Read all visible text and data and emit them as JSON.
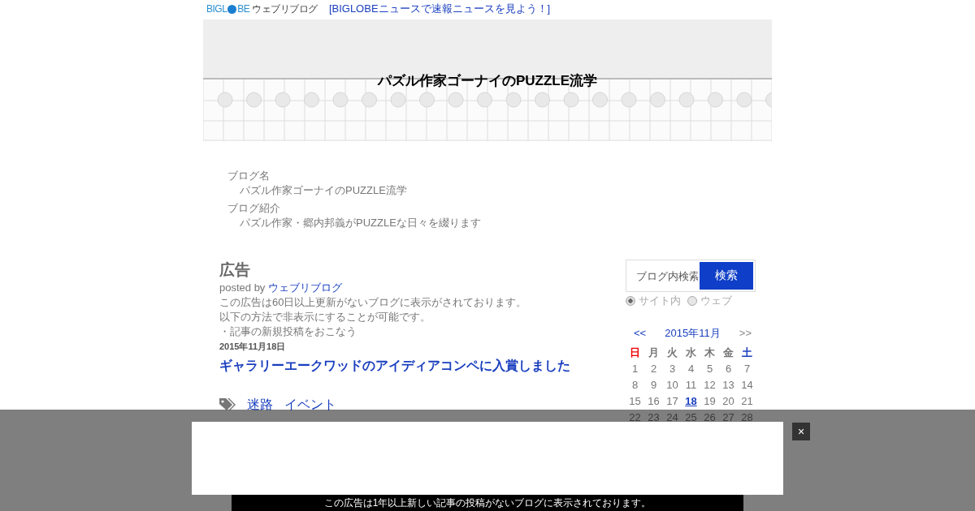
{
  "topbar": {
    "logo": {
      "left": "BIGL",
      "right": "BE",
      "suffix": "ウェブリブログ"
    },
    "news_link": "[BIGLOBEニュースで速報ニュースを見よう！]"
  },
  "banner": {
    "title": "パズル作家ゴーナイのPUZZLE流学"
  },
  "blog_info": [
    {
      "label": "ブログ名",
      "value": "パズル作家ゴーナイのPUZZLE流学"
    },
    {
      "label": "ブログ紹介",
      "value": "パズル作家・郷内邦義がPUZZLEな日々を綴ります"
    }
  ],
  "ad_post": {
    "title": "広告",
    "posted_by": "posted by",
    "author": "ウェブリブログ",
    "lines": [
      "この広告は60日以上更新がないブログに表示がされております。",
      "以下の方法で非表示にすることが可能です。",
      "・記事の新規投稿をおこなう"
    ]
  },
  "article": {
    "date": "2015年11月18日",
    "title": "ギャラリーエークワッドのアイディアコンペに入賞しました",
    "tags": [
      "迷路",
      "イベント"
    ]
  },
  "search": {
    "placeholder": "ブログ内検索",
    "button": "検索",
    "scopes": [
      {
        "label": "サイト内",
        "selected": true
      },
      {
        "label": "ウェブ",
        "selected": false
      }
    ]
  },
  "calendar": {
    "prev": "<<",
    "month": "2015年11月",
    "next": ">>",
    "weekdays": [
      {
        "label": "日",
        "kind": "sunday"
      },
      {
        "label": "月",
        "kind": "weekday"
      },
      {
        "label": "火",
        "kind": "weekday"
      },
      {
        "label": "水",
        "kind": "weekday"
      },
      {
        "label": "木",
        "kind": "weekday"
      },
      {
        "label": "金",
        "kind": "weekday"
      },
      {
        "label": "土",
        "kind": "saturday"
      }
    ],
    "weeks": [
      [
        {
          "day": "1",
          "linked": false
        },
        {
          "day": "2",
          "linked": false
        },
        {
          "day": "3",
          "linked": false
        },
        {
          "day": "4",
          "linked": false
        },
        {
          "day": "5",
          "linked": false
        },
        {
          "day": "6",
          "linked": false
        },
        {
          "day": "7",
          "linked": false
        }
      ],
      [
        {
          "day": "8",
          "linked": false
        },
        {
          "day": "9",
          "linked": false
        },
        {
          "day": "10",
          "linked": false
        },
        {
          "day": "11",
          "linked": false
        },
        {
          "day": "12",
          "linked": false
        },
        {
          "day": "13",
          "linked": false
        },
        {
          "day": "14",
          "linked": false
        }
      ],
      [
        {
          "day": "15",
          "linked": false
        },
        {
          "day": "16",
          "linked": false
        },
        {
          "day": "17",
          "linked": false
        },
        {
          "day": "18",
          "linked": true
        },
        {
          "day": "19",
          "linked": false
        },
        {
          "day": "20",
          "linked": false
        },
        {
          "day": "21",
          "linked": false
        }
      ],
      [
        {
          "day": "22",
          "linked": false
        },
        {
          "day": "23",
          "linked": false
        },
        {
          "day": "24",
          "linked": false
        },
        {
          "day": "25",
          "linked": false
        },
        {
          "day": "26",
          "linked": false
        },
        {
          "day": "27",
          "linked": false
        },
        {
          "day": "28",
          "linked": false
        }
      ]
    ]
  },
  "overlay_ad": {
    "close": "×",
    "notice": "この広告は1年以上新しい記事の投稿がないブログに表示されております。"
  }
}
